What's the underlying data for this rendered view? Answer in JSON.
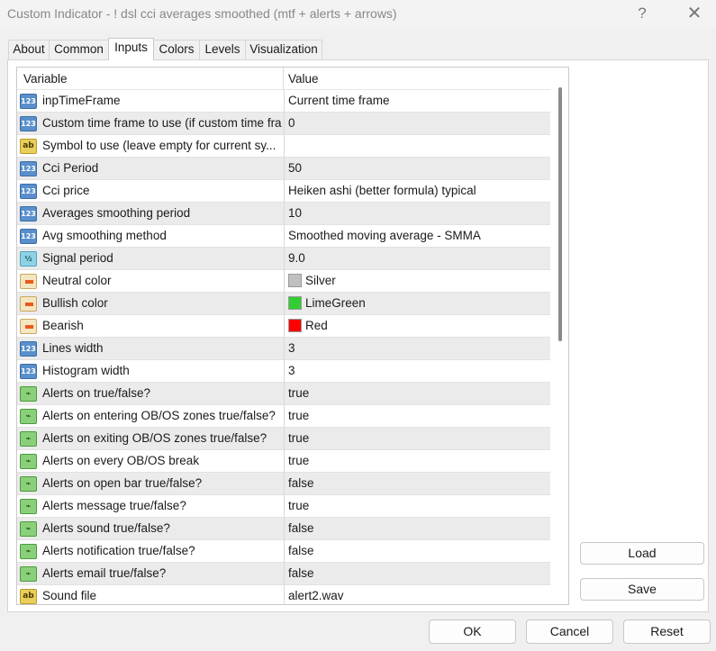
{
  "window": {
    "title": "Custom Indicator - ! dsl  cci averages smoothed (mtf + alerts + arrows)",
    "help": "?",
    "close": "✕"
  },
  "tabs": [
    {
      "label": "About"
    },
    {
      "label": "Common"
    },
    {
      "label": "Inputs",
      "active": true
    },
    {
      "label": "Colors"
    },
    {
      "label": "Levels"
    },
    {
      "label": "Visualization"
    }
  ],
  "grid": {
    "col_variable": "Variable",
    "col_value": "Value",
    "rows": [
      {
        "type": "int",
        "icon_text": "123",
        "name": "inpTimeFrame",
        "value": "Current time frame"
      },
      {
        "type": "int",
        "icon_text": "123",
        "name": "Custom time frame to use (if custom time fra...",
        "value": "0"
      },
      {
        "type": "str",
        "icon_text": "ab",
        "name": "Symbol to use (leave empty for current sy...",
        "value": ""
      },
      {
        "type": "int",
        "icon_text": "123",
        "name": "Cci Period",
        "value": "50"
      },
      {
        "type": "int",
        "icon_text": "123",
        "name": "Cci price",
        "value": "Heiken ashi (better formula) typical"
      },
      {
        "type": "int",
        "icon_text": "123",
        "name": "Averages smoothing period",
        "value": "10"
      },
      {
        "type": "int",
        "icon_text": "123",
        "name": "Avg smoothing method",
        "value": "Smoothed moving average - SMMA"
      },
      {
        "type": "dbl",
        "icon_text": "½",
        "name": "Signal period",
        "value": "9.0"
      },
      {
        "type": "clr",
        "icon_text": "",
        "name": "Neutral color",
        "value": "Silver",
        "swatch": "#c0c0c0"
      },
      {
        "type": "clr",
        "icon_text": "",
        "name": "Bullish color",
        "value": "LimeGreen",
        "swatch": "#32cd32"
      },
      {
        "type": "clr",
        "icon_text": "",
        "name": "Bearish",
        "value": "Red",
        "swatch": "#ff0000"
      },
      {
        "type": "int",
        "icon_text": "123",
        "name": "Lines width",
        "value": "3"
      },
      {
        "type": "int",
        "icon_text": "123",
        "name": "Histogram width",
        "value": "3"
      },
      {
        "type": "bool",
        "icon_text": "⌁",
        "name": "Alerts on true/false?",
        "value": "true"
      },
      {
        "type": "bool",
        "icon_text": "⌁",
        "name": "Alerts on entering OB/OS zones true/false?",
        "value": "true"
      },
      {
        "type": "bool",
        "icon_text": "⌁",
        "name": "Alerts on exiting OB/OS zones true/false?",
        "value": "true"
      },
      {
        "type": "bool",
        "icon_text": "⌁",
        "name": "Alerts on every OB/OS break",
        "value": "true"
      },
      {
        "type": "bool",
        "icon_text": "⌁",
        "name": "Alerts on open bar true/false?",
        "value": "false"
      },
      {
        "type": "bool",
        "icon_text": "⌁",
        "name": "Alerts message true/false?",
        "value": "true"
      },
      {
        "type": "bool",
        "icon_text": "⌁",
        "name": "Alerts sound true/false?",
        "value": "false"
      },
      {
        "type": "bool",
        "icon_text": "⌁",
        "name": "Alerts notification true/false?",
        "value": "false"
      },
      {
        "type": "bool",
        "icon_text": "⌁",
        "name": "Alerts email true/false?",
        "value": "false"
      },
      {
        "type": "str",
        "icon_text": "ab",
        "name": "Sound file",
        "value": "alert2.wav"
      }
    ]
  },
  "buttons": {
    "load": "Load",
    "save": "Save",
    "ok": "OK",
    "cancel": "Cancel",
    "reset": "Reset"
  }
}
